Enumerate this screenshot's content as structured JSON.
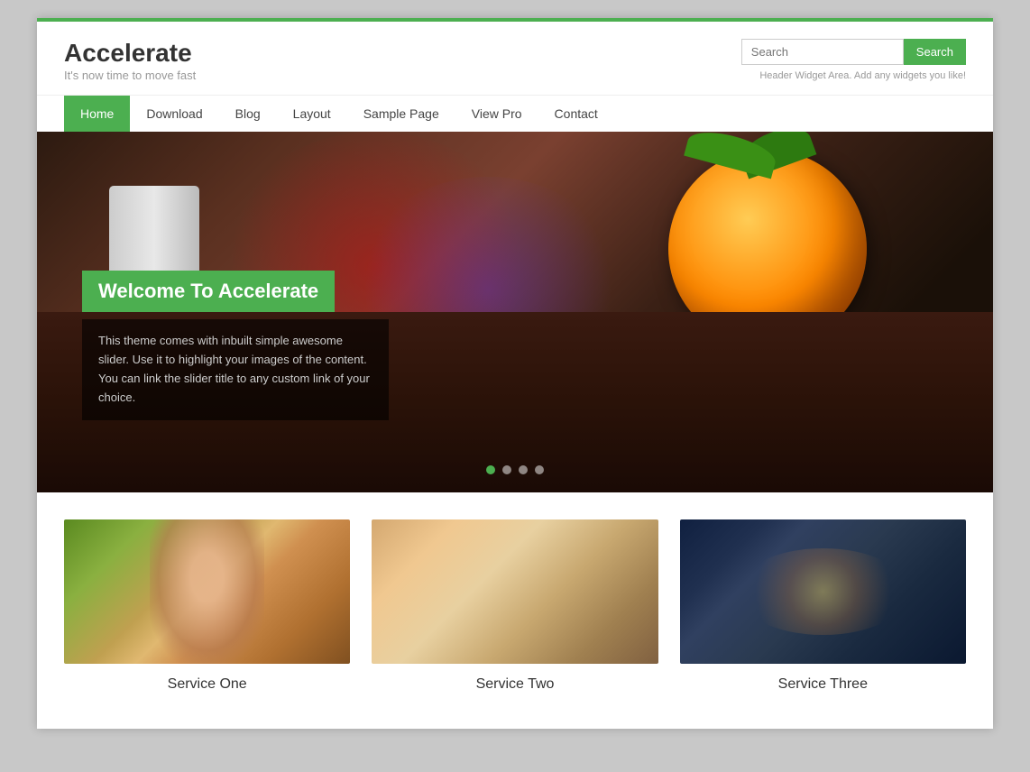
{
  "site": {
    "title": "Accelerate",
    "tagline": "It's now time to move fast"
  },
  "header": {
    "search_placeholder": "Search",
    "search_button": "Search",
    "widget_text": "Header Widget Area. Add any widgets you like!"
  },
  "nav": {
    "items": [
      {
        "label": "Home",
        "active": true
      },
      {
        "label": "Download",
        "active": false
      },
      {
        "label": "Blog",
        "active": false
      },
      {
        "label": "Layout",
        "active": false
      },
      {
        "label": "Sample Page",
        "active": false
      },
      {
        "label": "View Pro",
        "active": false
      },
      {
        "label": "Contact",
        "active": false
      }
    ]
  },
  "slider": {
    "title": "Welcome To Accelerate",
    "description": "This theme comes with inbuilt simple awesome slider. Use it to highlight your images of the content. You can link the slider title to any custom link of your choice.",
    "dots": [
      "active",
      "",
      "",
      ""
    ]
  },
  "services": {
    "items": [
      {
        "title": "Service One"
      },
      {
        "title": "Service Two"
      },
      {
        "title": "Service Three"
      }
    ]
  },
  "colors": {
    "accent": "#4caf50"
  }
}
